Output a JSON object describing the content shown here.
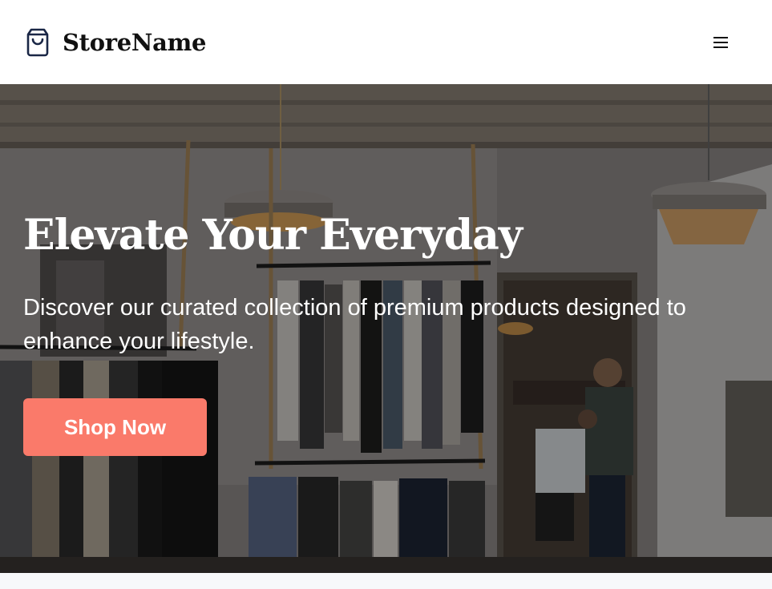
{
  "header": {
    "brand_name": "StoreName",
    "brand_icon": "shopping-bag-icon",
    "menu_icon": "hamburger-menu-icon"
  },
  "hero": {
    "title": "Elevate Your Everyday",
    "subtitle": "Discover our curated collection of premium products designed to enhance your lifestyle.",
    "cta_label": "Shop Now"
  },
  "colors": {
    "accent": "#fa7a6a",
    "header_bg": "#ffffff",
    "icon_color": "#1a2746"
  }
}
